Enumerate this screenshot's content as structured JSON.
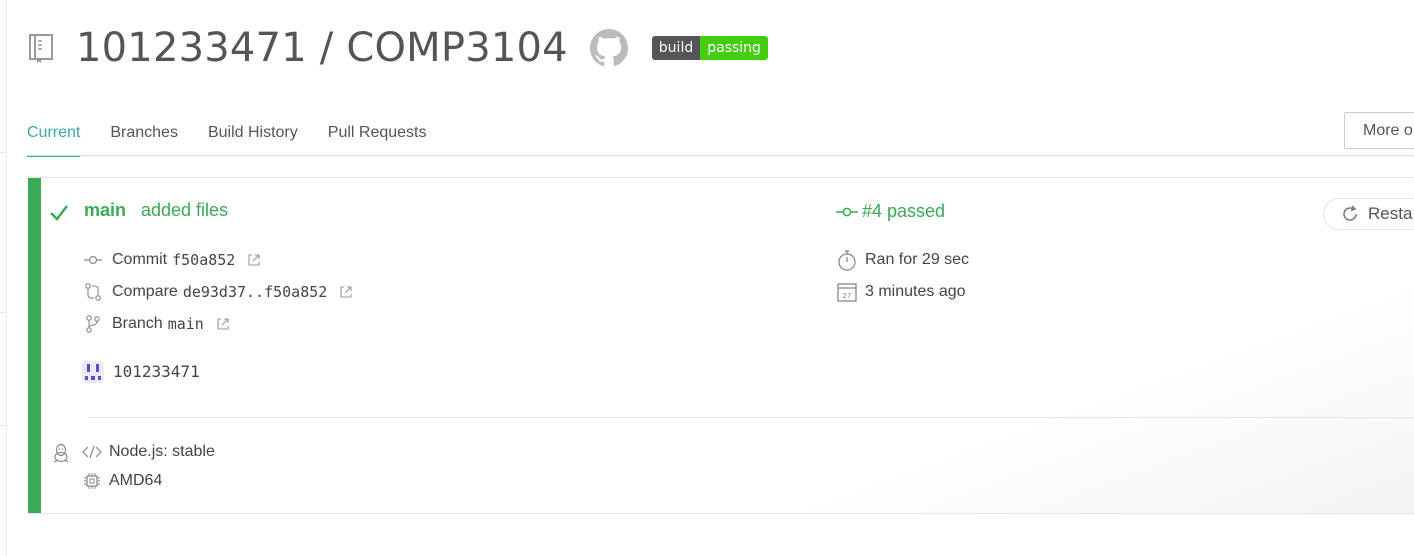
{
  "repo": {
    "owner": "101233471",
    "name": "COMP3104",
    "title": "101233471 / COMP3104",
    "badge_left": "build",
    "badge_right": "passing",
    "badge_color": "#44cc11"
  },
  "tabs": [
    {
      "label": "Current",
      "active": true
    },
    {
      "label": "Branches",
      "active": false
    },
    {
      "label": "Build History",
      "active": false
    },
    {
      "label": "Pull Requests",
      "active": false
    }
  ],
  "more_options_label": "More o",
  "build": {
    "status_color": "#39aa56",
    "branch": "main",
    "message": "added files",
    "commit_label": "Commit",
    "commit_sha": "f50a852",
    "compare_label": "Compare",
    "compare_range": "de93d37..f50a852",
    "branch_label": "Branch",
    "branch_value": "main",
    "author": "101233471",
    "number_status": "#4 passed",
    "duration": "Ran for 29 sec",
    "finished": "3 minutes ago",
    "calendar_day": "27",
    "restart_label": "Resta",
    "language": "Node.js: stable",
    "arch": "AMD64"
  },
  "icons": [
    "repo-icon",
    "github-icon",
    "check-icon",
    "commit-icon",
    "compare-icon",
    "branch-icon",
    "external-link-icon",
    "stopwatch-icon",
    "calendar-icon",
    "restart-icon",
    "linux-icon",
    "code-icon",
    "cpu-icon"
  ]
}
